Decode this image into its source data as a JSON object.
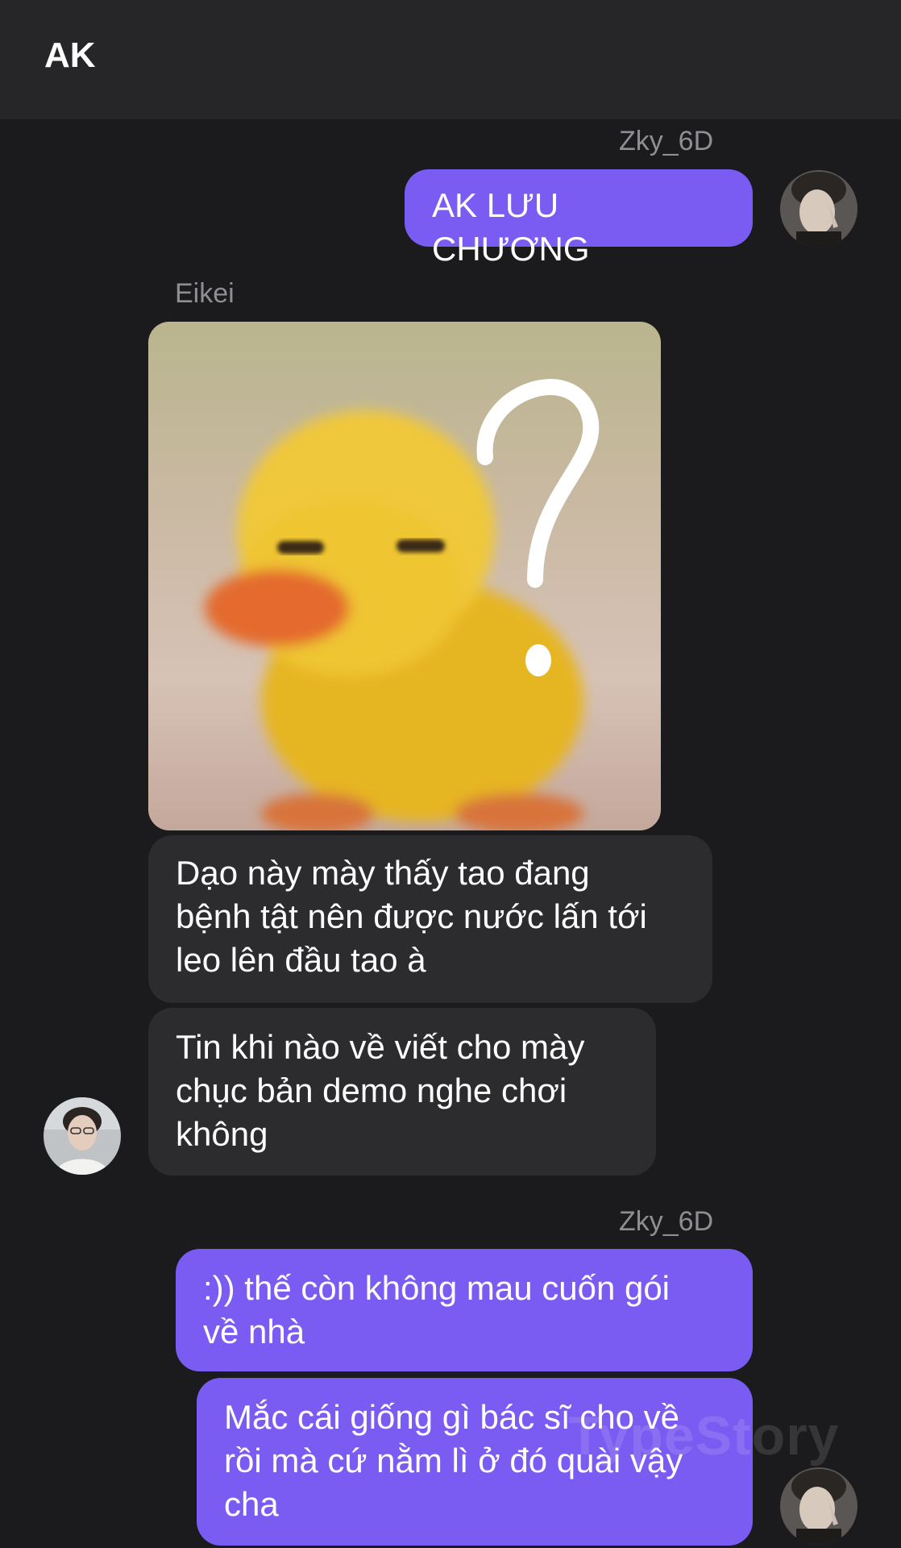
{
  "header": {
    "title": "AK"
  },
  "messages": [
    {
      "sender": "Zky_6D",
      "text": "AK LƯU CHƯƠNG"
    },
    {
      "sender": "Eikei",
      "image": "blurry-yellow-duck-with-question-mark-meme"
    },
    {
      "text_lines": [
        "Dạo này mày thấy tao đang",
        "bệnh tật nên được nước lấn tới",
        "leo lên đầu tao à"
      ]
    },
    {
      "text_lines": [
        "Tin khi nào về viết cho mày",
        "chục bản demo nghe chơi",
        "không"
      ]
    },
    {
      "sender": "Zky_6D",
      "text_lines": [
        ":)) thế còn không mau cuốn gói",
        "về nhà"
      ]
    },
    {
      "text_lines": [
        "Mắc cái giống gì bác sĩ cho về",
        "rồi mà cứ nằm lì ở đó quài vậy",
        "cha"
      ]
    }
  ],
  "watermark": "TypeStory",
  "colors": {
    "outgoing_bubble": "#7a5cf2",
    "incoming_bubble": "#2c2c2e",
    "background": "#1b1b1d",
    "header": "#262628"
  }
}
